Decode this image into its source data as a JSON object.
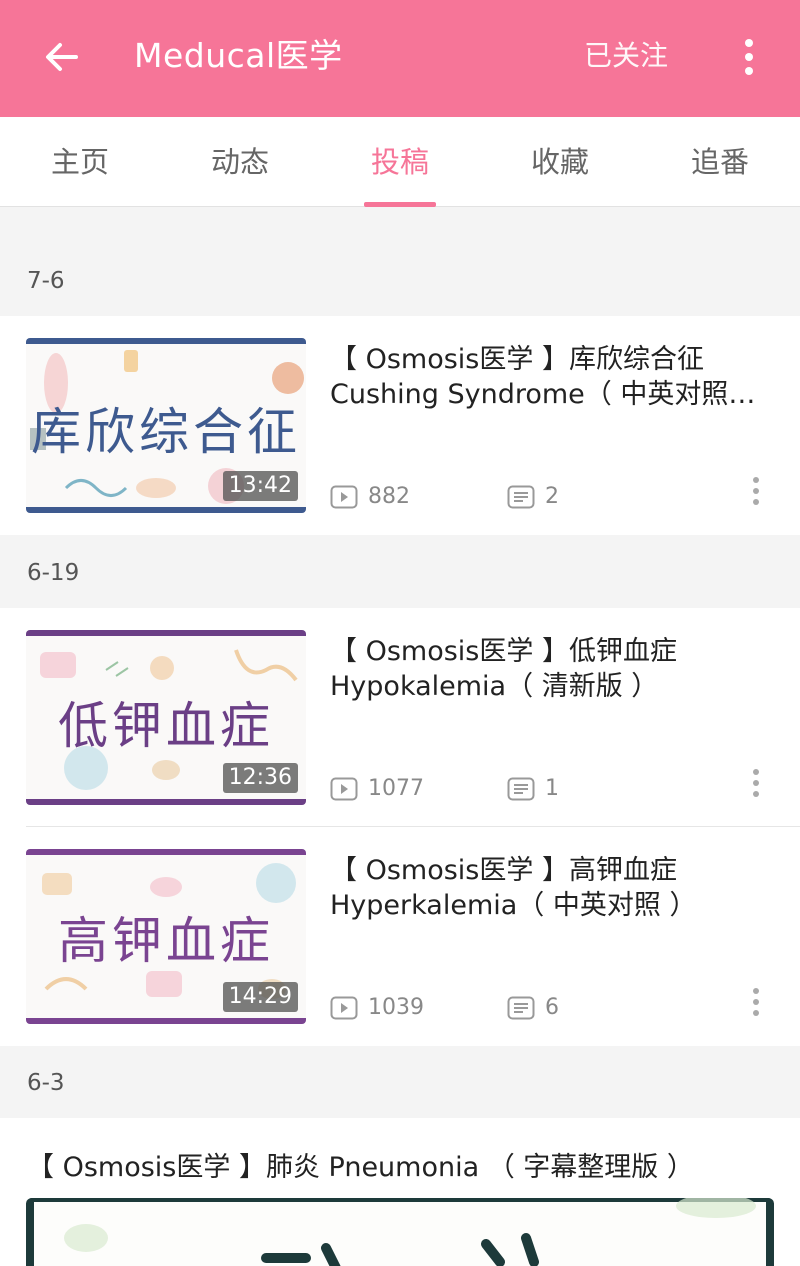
{
  "appbar": {
    "title": "Meducal医学",
    "follow_label": "已关注",
    "back_icon": "arrow-left-icon",
    "more_icon": "more-vert-icon",
    "background": "#f67598"
  },
  "tabs": [
    {
      "label": "主页",
      "active": false
    },
    {
      "label": "动态",
      "active": false
    },
    {
      "label": "投稿",
      "active": true
    },
    {
      "label": "收藏",
      "active": false
    },
    {
      "label": "追番",
      "active": false
    }
  ],
  "sections": [
    {
      "date": "7-6",
      "videos": [
        {
          "title_line1": "【 Osmosis医学 】库欣综合征",
          "title_line2": "Cushing Syndrome（ 中英对照…",
          "thumb_text": "库欣综合征",
          "thumb_color": "#3e5a8f",
          "duration": "13:42",
          "views": "882",
          "comments": "2"
        }
      ]
    },
    {
      "date": "6-19",
      "videos": [
        {
          "title_line1": "【 Osmosis医学 】低钾血症",
          "title_line2": "Hypokalemia（ 清新版 ）",
          "thumb_text": "低钾血症",
          "thumb_color": "#6b3f86",
          "duration": "12:36",
          "views": "1077",
          "comments": "1"
        },
        {
          "title_line1": "【 Osmosis医学 】高钾血症",
          "title_line2": "Hyperkalemia（ 中英对照 ）",
          "thumb_text": "高钾血症",
          "thumb_color": "#7a4491",
          "duration": "14:29",
          "views": "1039",
          "comments": "6"
        }
      ]
    },
    {
      "date": "6-3",
      "featured": {
        "title": "【 Osmosis医学 】肺炎 Pneumonia （ 字幕整理版 ）"
      }
    }
  ]
}
